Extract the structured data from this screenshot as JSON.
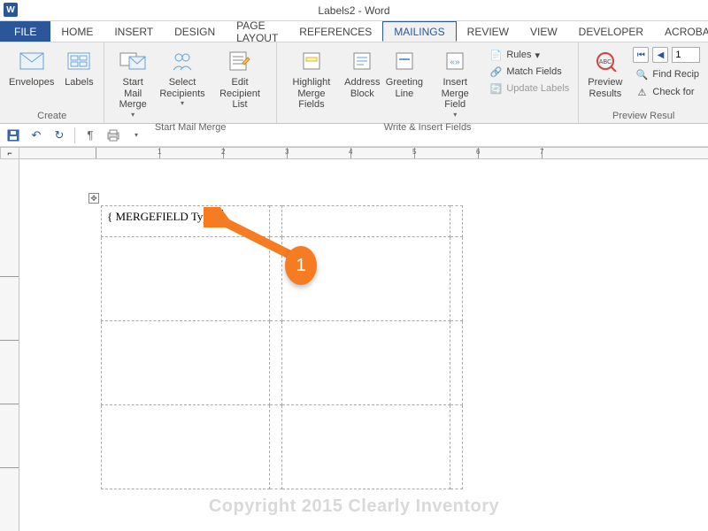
{
  "titlebar": {
    "word_icon": "W",
    "title": "Labels2 - Word"
  },
  "tabs": {
    "file": "FILE",
    "items": [
      "HOME",
      "INSERT",
      "DESIGN",
      "PAGE LAYOUT",
      "REFERENCES",
      "MAILINGS",
      "REVIEW",
      "VIEW",
      "DEVELOPER",
      "ACROBAT"
    ],
    "active": "MAILINGS"
  },
  "ribbon": {
    "create": {
      "envelopes": "Envelopes",
      "labels": "Labels",
      "group": "Create"
    },
    "startmm": {
      "start": "Start Mail\nMerge",
      "select": "Select\nRecipients",
      "edit": "Edit\nRecipient List",
      "group": "Start Mail Merge"
    },
    "write": {
      "highlight": "Highlight\nMerge Fields",
      "address": "Address\nBlock",
      "greeting": "Greeting\nLine",
      "insertmf": "Insert Merge\nField",
      "rules": "Rules",
      "match": "Match Fields",
      "update": "Update Labels",
      "group": "Write & Insert Fields"
    },
    "preview": {
      "preview": "Preview\nResults",
      "find": "Find Recip",
      "check": "Check for",
      "group": "Preview Resul",
      "record": "1"
    }
  },
  "qat": {
    "save": "💾",
    "undo": "↶",
    "redo": "↻"
  },
  "ruler": {
    "marks": [
      "1",
      "2",
      "3",
      "4",
      "5",
      "6",
      "7"
    ]
  },
  "document": {
    "mergefield_text": "{ MERGEFIELD Type }"
  },
  "callout": {
    "number": "1"
  },
  "watermark": "Copyright 2015 Clearly Inventory"
}
